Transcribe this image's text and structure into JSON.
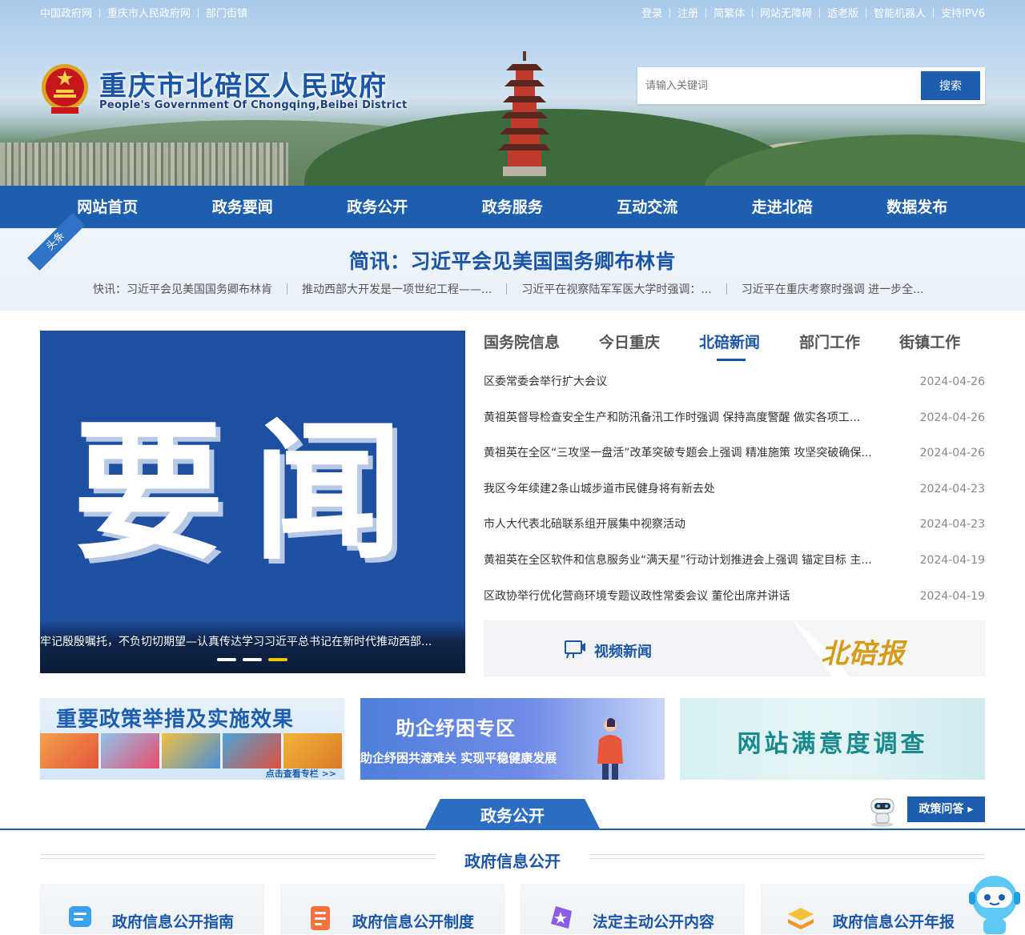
{
  "top_links_left": [
    "中国政府网",
    "重庆市人民政府网",
    "部门街镇"
  ],
  "top_links_right": [
    "登录",
    "注册",
    "简繁体",
    "网站无障碍",
    "适老版",
    "智能机器人",
    "支持IPV6"
  ],
  "site": {
    "title": "重庆市北碚区人民政府",
    "subtitle": "People's Government Of Chongqing,Beibei District"
  },
  "search": {
    "placeholder": "请输入关键词",
    "button_label": "搜索"
  },
  "nav": [
    "网站首页",
    "政务要闻",
    "政务公开",
    "政务服务",
    "互动交流",
    "走进北碚",
    "数据发布"
  ],
  "headline": {
    "tag": "头条",
    "title": "简讯：习近平会见美国国务卿布林肯",
    "quick_news": [
      "快讯：习近平会见美国国务卿布林肯",
      "推动西部大开发是一项世纪工程——...",
      "习近平在视察陆军军医大学时强调：...",
      "习近平在重庆考察时强调 进一步全..."
    ]
  },
  "carousel": {
    "image_text": "要闻",
    "caption": "牢记殷殷嘱托，不负切切期望—认真传达学习习近平总书记在新时代推动西部...",
    "active_dot": 3,
    "dots": 3
  },
  "tabs": {
    "items": [
      "国务院信息",
      "今日重庆",
      "北碚新闻",
      "部门工作",
      "街镇工作"
    ],
    "active": 2
  },
  "news": [
    {
      "title": "区委常委会举行扩大会议",
      "date": "2024-04-26"
    },
    {
      "title": "黄祖英督导检查安全生产和防汛备汛工作时强调 保持高度警醒 做实各项工...",
      "date": "2024-04-26"
    },
    {
      "title": "黄祖英在全区“三攻坚一盘活”改革突破专题会上强调 精准施策 攻坚突破确保...",
      "date": "2024-04-26"
    },
    {
      "title": "我区今年续建2条山城步道市民健身将有新去处",
      "date": "2024-04-23"
    },
    {
      "title": "市人大代表北碚联系组开展集中视察活动",
      "date": "2024-04-23"
    },
    {
      "title": "黄祖英在全区软件和信息服务业“满天星”行动计划推进会上强调 锚定目标 主...",
      "date": "2024-04-19"
    },
    {
      "title": "区政协举行优化营商环境专题议政性常委会议 董伦出席并讲话",
      "date": "2024-04-19"
    }
  ],
  "video_banner": {
    "label": "视频新闻",
    "newspaper": "北碚报"
  },
  "banners": {
    "policy": {
      "title": "重要政策举措及实施效果",
      "more": "点击查看专栏 >>"
    },
    "help": {
      "title": "助企纾困专区",
      "subtitle": "助企纾困共渡难关  实现平稳健康发展"
    },
    "survey": {
      "title": "网站满意度调查"
    }
  },
  "section": {
    "title": "政务公开",
    "qa_button": "政策问答",
    "subsection": "政府信息公开",
    "cards": [
      "政府信息公开指南",
      "政府信息公开制度",
      "法定主动公开内容",
      "政府信息公开年报"
    ]
  },
  "colors": {
    "primary": "#1d5fae",
    "accent": "#f2c200",
    "title_blue": "#1a55a8"
  }
}
